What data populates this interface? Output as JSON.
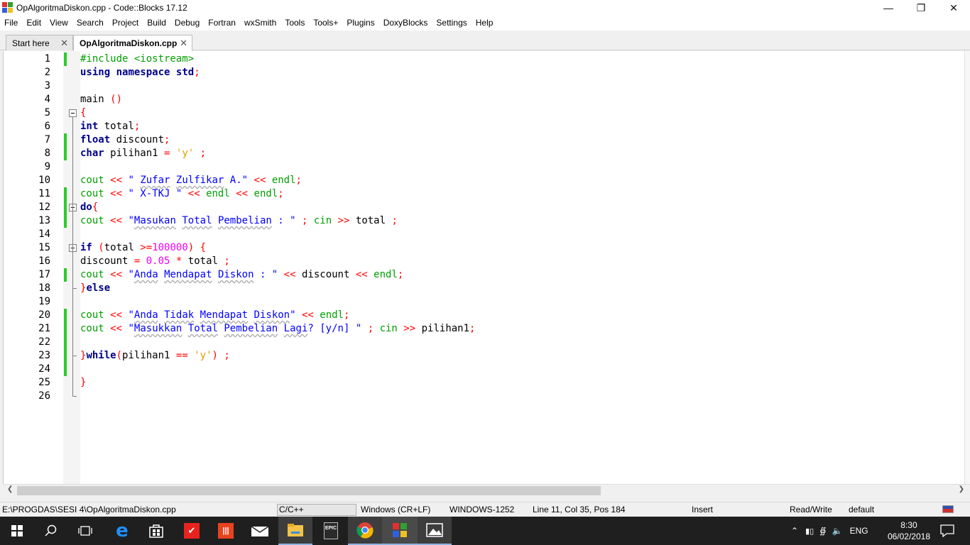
{
  "window": {
    "title": "OpAlgoritmaDiskon.cpp - Code::Blocks 17.12",
    "controls": [
      "minimize",
      "restore",
      "close"
    ]
  },
  "menu": [
    "File",
    "Edit",
    "View",
    "Search",
    "Project",
    "Build",
    "Debug",
    "Fortran",
    "wxSmith",
    "Tools",
    "Tools+",
    "Plugins",
    "DoxyBlocks",
    "Settings",
    "Help"
  ],
  "tabs": [
    {
      "label": "Start here",
      "active": false
    },
    {
      "label": "OpAlgoritmaDiskon.cpp",
      "active": true
    }
  ],
  "editor": {
    "lines": [
      {
        "n": "1",
        "text": "#include <iostream>"
      },
      {
        "n": "2",
        "text": "using namespace std;"
      },
      {
        "n": "3",
        "text": ""
      },
      {
        "n": "4",
        "text": "main ()"
      },
      {
        "n": "5",
        "text": "{"
      },
      {
        "n": "6",
        "text": "int total;"
      },
      {
        "n": "7",
        "text": "float discount;"
      },
      {
        "n": "8",
        "text": "char pilihan1 = 'y' ;"
      },
      {
        "n": "9",
        "text": ""
      },
      {
        "n": "10",
        "text": "cout << \" Zufar Zulfikar A.\" << endl;"
      },
      {
        "n": "11",
        "text": "cout << \" X-TKJ \" << endl << endl;"
      },
      {
        "n": "12",
        "text": "do{"
      },
      {
        "n": "13",
        "text": "cout << \"Masukan Total Pembelian : \" ; cin >> total ;"
      },
      {
        "n": "14",
        "text": ""
      },
      {
        "n": "15",
        "text": "if (total >=100000) {"
      },
      {
        "n": "16",
        "text": "discount = 0.05 * total ;"
      },
      {
        "n": "17",
        "text": "cout << \"Anda Mendapat Diskon : \" << discount << endl;"
      },
      {
        "n": "18",
        "text": "}else"
      },
      {
        "n": "19",
        "text": ""
      },
      {
        "n": "20",
        "text": "cout << \"Anda Tidak Mendapat Diskon\" << endl;"
      },
      {
        "n": "21",
        "text": "cout << \"Masukkan Total Pembelian Lagi? [y/n] \" ; cin >> pilihan1;"
      },
      {
        "n": "22",
        "text": ""
      },
      {
        "n": "23",
        "text": "}while(pilihan1 == 'y') ;"
      },
      {
        "n": "24",
        "text": ""
      },
      {
        "n": "25",
        "text": "}"
      },
      {
        "n": "26",
        "text": ""
      }
    ]
  },
  "status": {
    "path": "E:\\PROGDAS\\SESI 4\\OpAlgoritmaDiskon.cpp",
    "language": "C/C++",
    "line_endings": "Windows (CR+LF)",
    "encoding": "WINDOWS-1252",
    "position": "Line 11, Col 35, Pos 184",
    "mode": "Insert",
    "access": "Read/Write",
    "profile": "default"
  },
  "taskbar": {
    "language": "ENG",
    "time": "8:30",
    "date": "06/02/2018",
    "icons": [
      "start-icon",
      "search-icon",
      "task-view-icon",
      "edge-icon",
      "store-icon",
      "app-red-icon",
      "app-red2-icon",
      "mail-icon",
      "explorer-icon",
      "epic-games-icon",
      "chrome-icon",
      "codeblocks-icon",
      "photos-icon"
    ]
  },
  "colors": {
    "keyword": "#00008b",
    "preprocessor": "#00a000",
    "operator": "#ff0000",
    "string": "#0000ff",
    "number": "#f000f0",
    "char": "#e0a000",
    "changebar": "#2bcc2b"
  }
}
